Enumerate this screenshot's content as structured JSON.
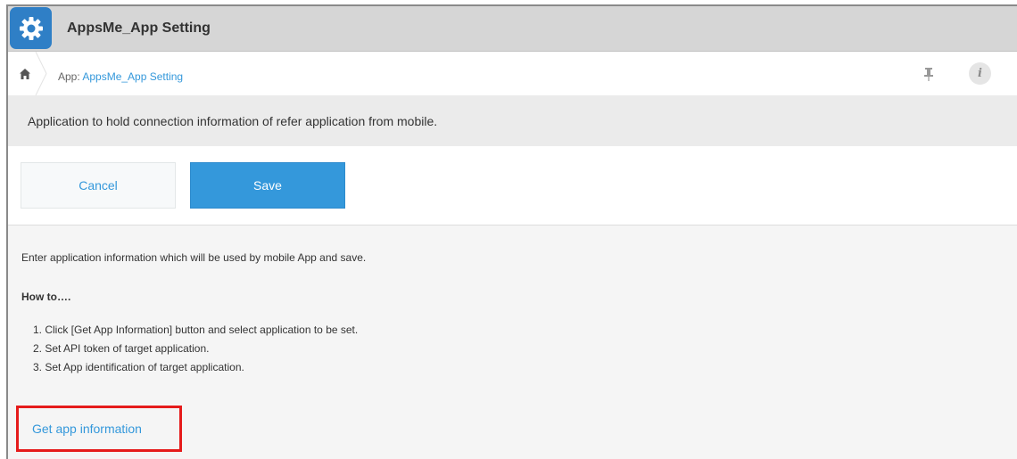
{
  "window": {
    "title": "AppsMe_App Setting",
    "icon": "gear-icon",
    "accent_color": "#2f7fc6"
  },
  "breadcrumb": {
    "home_icon": "home-icon",
    "prefix": "App: ",
    "app_link": "AppsMe_App Setting",
    "pin_icon": "pin-icon",
    "info_icon": "info-icon",
    "info_glyph": "i"
  },
  "description": "Application to hold connection information of refer application from mobile.",
  "toolbar": {
    "cancel_label": "Cancel",
    "save_label": "Save",
    "save_color": "#3498db"
  },
  "content": {
    "intro": "Enter application information which will be used by mobile App and save.",
    "howto_heading": "How to….",
    "steps": [
      "1. Click [Get App Information] button and select application to be set.",
      "2. Set API token of target application.",
      "3. Set App identification of target application."
    ],
    "get_info_link": "Get app information",
    "highlight_color": "#e51b1b"
  }
}
